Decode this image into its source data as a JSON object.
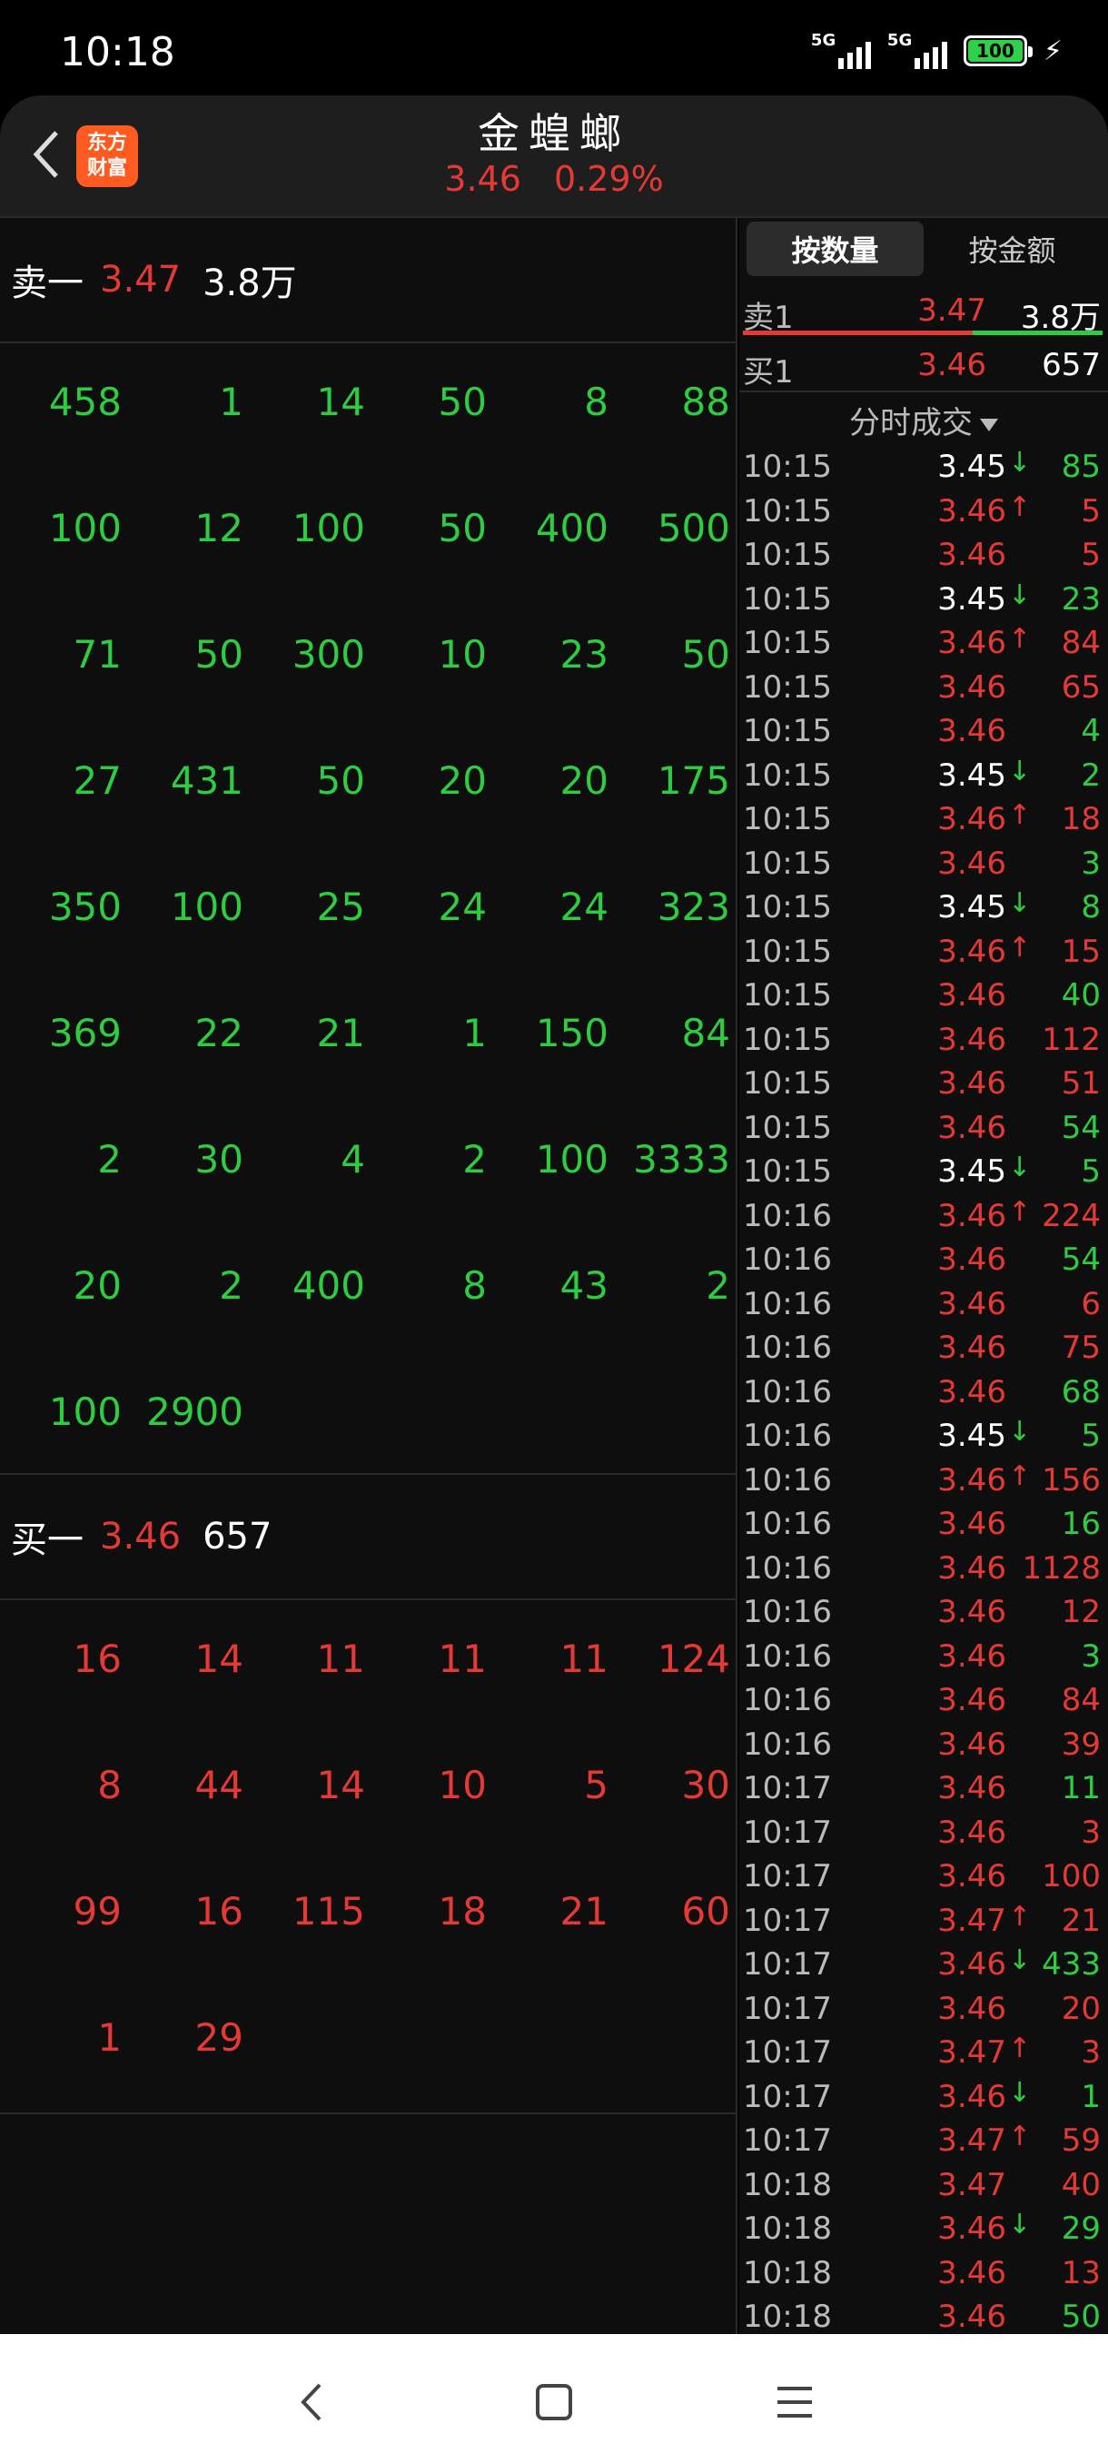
{
  "status": {
    "time": "10:18",
    "sig1": "5G",
    "sig2": "5G",
    "battery": "100"
  },
  "header": {
    "logo_line1": "东方",
    "logo_line2": "财富",
    "title": "金蝗螂",
    "price": "3.46",
    "change": "0.29%"
  },
  "sell": {
    "label": "卖一",
    "price": "3.47",
    "volume": "3.8万",
    "grid": [
      [
        "458",
        "1",
        "14",
        "50",
        "8",
        "88"
      ],
      [
        "100",
        "12",
        "100",
        "50",
        "400",
        "500"
      ],
      [
        "71",
        "50",
        "300",
        "10",
        "23",
        "50"
      ],
      [
        "27",
        "431",
        "50",
        "20",
        "20",
        "175"
      ],
      [
        "350",
        "100",
        "25",
        "24",
        "24",
        "323"
      ],
      [
        "369",
        "22",
        "21",
        "1",
        "150",
        "84"
      ],
      [
        "2",
        "30",
        "4",
        "2",
        "100",
        "3333"
      ],
      [
        "20",
        "2",
        "400",
        "8",
        "43",
        "2"
      ],
      [
        "100",
        "2900"
      ]
    ]
  },
  "buy": {
    "label": "买一",
    "price": "3.46",
    "volume": "657",
    "grid": [
      [
        "16",
        "14",
        "11",
        "11",
        "11",
        "124"
      ],
      [
        "8",
        "44",
        "14",
        "10",
        "5",
        "30"
      ],
      [
        "99",
        "16",
        "115",
        "18",
        "21",
        "60"
      ],
      [
        "1",
        "29"
      ]
    ]
  },
  "right": {
    "tabs": [
      "按数量",
      "按金额"
    ],
    "ask": {
      "label": "卖1",
      "price": "3.47",
      "volume": "3.8万"
    },
    "bid": {
      "label": "买1",
      "price": "3.46",
      "volume": "657"
    },
    "ticks_title": "分时成交",
    "ticks": [
      {
        "t": "10:15",
        "p": "3.45",
        "d": "down",
        "v": "85"
      },
      {
        "t": "10:15",
        "p": "3.46",
        "d": "up",
        "v": "5"
      },
      {
        "t": "10:15",
        "p": "3.46",
        "d": "",
        "v": "5"
      },
      {
        "t": "10:15",
        "p": "3.45",
        "d": "down",
        "v": "23"
      },
      {
        "t": "10:15",
        "p": "3.46",
        "d": "up",
        "v": "84"
      },
      {
        "t": "10:15",
        "p": "3.46",
        "d": "",
        "v": "65"
      },
      {
        "t": "10:15",
        "p": "3.46",
        "d": "",
        "v": "4"
      },
      {
        "t": "10:15",
        "p": "3.45",
        "d": "down",
        "v": "2"
      },
      {
        "t": "10:15",
        "p": "3.46",
        "d": "up",
        "v": "18"
      },
      {
        "t": "10:15",
        "p": "3.46",
        "d": "",
        "v": "3"
      },
      {
        "t": "10:15",
        "p": "3.45",
        "d": "down",
        "v": "8"
      },
      {
        "t": "10:15",
        "p": "3.46",
        "d": "up",
        "v": "15"
      },
      {
        "t": "10:15",
        "p": "3.46",
        "d": "",
        "v": "40"
      },
      {
        "t": "10:15",
        "p": "3.46",
        "d": "",
        "v": "112"
      },
      {
        "t": "10:15",
        "p": "3.46",
        "d": "",
        "v": "51"
      },
      {
        "t": "10:15",
        "p": "3.46",
        "d": "",
        "v": "54"
      },
      {
        "t": "10:15",
        "p": "3.45",
        "d": "down",
        "v": "5"
      },
      {
        "t": "10:16",
        "p": "3.46",
        "d": "up",
        "v": "224"
      },
      {
        "t": "10:16",
        "p": "3.46",
        "d": "",
        "v": "54"
      },
      {
        "t": "10:16",
        "p": "3.46",
        "d": "",
        "v": "6"
      },
      {
        "t": "10:16",
        "p": "3.46",
        "d": "",
        "v": "75"
      },
      {
        "t": "10:16",
        "p": "3.46",
        "d": "",
        "v": "68"
      },
      {
        "t": "10:16",
        "p": "3.45",
        "d": "down",
        "v": "5"
      },
      {
        "t": "10:16",
        "p": "3.46",
        "d": "up",
        "v": "156"
      },
      {
        "t": "10:16",
        "p": "3.46",
        "d": "",
        "v": "16"
      },
      {
        "t": "10:16",
        "p": "3.46",
        "d": "",
        "v": "1128"
      },
      {
        "t": "10:16",
        "p": "3.46",
        "d": "",
        "v": "12"
      },
      {
        "t": "10:16",
        "p": "3.46",
        "d": "",
        "v": "3"
      },
      {
        "t": "10:16",
        "p": "3.46",
        "d": "",
        "v": "84"
      },
      {
        "t": "10:16",
        "p": "3.46",
        "d": "",
        "v": "39"
      },
      {
        "t": "10:17",
        "p": "3.46",
        "d": "",
        "v": "11"
      },
      {
        "t": "10:17",
        "p": "3.46",
        "d": "",
        "v": "3"
      },
      {
        "t": "10:17",
        "p": "3.46",
        "d": "",
        "v": "100"
      },
      {
        "t": "10:17",
        "p": "3.47",
        "d": "up",
        "v": "21"
      },
      {
        "t": "10:17",
        "p": "3.46",
        "d": "down",
        "v": "433"
      },
      {
        "t": "10:17",
        "p": "3.46",
        "d": "",
        "v": "20"
      },
      {
        "t": "10:17",
        "p": "3.47",
        "d": "up",
        "v": "3"
      },
      {
        "t": "10:17",
        "p": "3.46",
        "d": "down",
        "v": "1"
      },
      {
        "t": "10:17",
        "p": "3.47",
        "d": "up",
        "v": "59"
      },
      {
        "t": "10:18",
        "p": "3.47",
        "d": "",
        "v": "40"
      },
      {
        "t": "10:18",
        "p": "3.46",
        "d": "down",
        "v": "29"
      },
      {
        "t": "10:18",
        "p": "3.46",
        "d": "",
        "v": "13"
      },
      {
        "t": "10:18",
        "p": "3.46",
        "d": "",
        "v": "50"
      }
    ]
  },
  "colors": {
    "up": "#e53935",
    "down": "#2ecc40",
    "neutral": "#ffffff"
  }
}
